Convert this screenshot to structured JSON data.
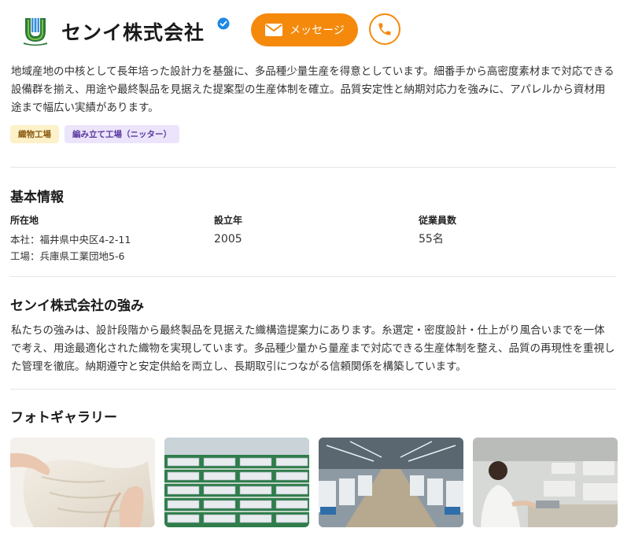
{
  "company": {
    "name": "センイ株式会社",
    "verified": true
  },
  "actions": {
    "message_label": "メッセージ",
    "message_icon": "envelope-icon",
    "phone_icon": "phone-icon"
  },
  "colors": {
    "accent": "#f5890c",
    "verified": "#1e88e5"
  },
  "description": "地域産地の中核として長年培った設計力を基盤に、多品種少量生産を得意としています。細番手から高密度素材まで対応できる設備群を揃え、用途や最終製品を見据えた提案型の生産体制を確立。品質安定性と納期対応力を強みに、アパレルから資材用途まで幅広い実績があります。",
  "tags": [
    "織物工場",
    "編み立て工場（ニッター）"
  ],
  "basic_info": {
    "title": "基本情報",
    "location_label": "所在地",
    "location_lines": [
      "本社：福井県中央区4-2-11",
      "工場：兵庫県工業団地5-6"
    ],
    "founded_label": "設立年",
    "founded_value": "2005",
    "employees_label": "従業員数",
    "employees_value": "55名"
  },
  "strengths": {
    "title": "センイ株式会社の強み",
    "text": "私たちの強みは、設計段階から最終製品を見据えた織構造提案力にあります。糸選定・密度設計・仕上がり風合いまでを一体で考え、用途最適化された織物を実現しています。多品種少量から量産まで対応できる生産体制を整え、品質の再現性を重視した管理を徹底。納期遵守と安定供給を両立し、長期取引につながる信頼関係を構築しています。"
  },
  "gallery": {
    "title": "フォトギャラリー",
    "photos": [
      "fabric-photo",
      "factory-overview-photo",
      "weaving-line-photo",
      "sewing-workshop-photo"
    ]
  }
}
